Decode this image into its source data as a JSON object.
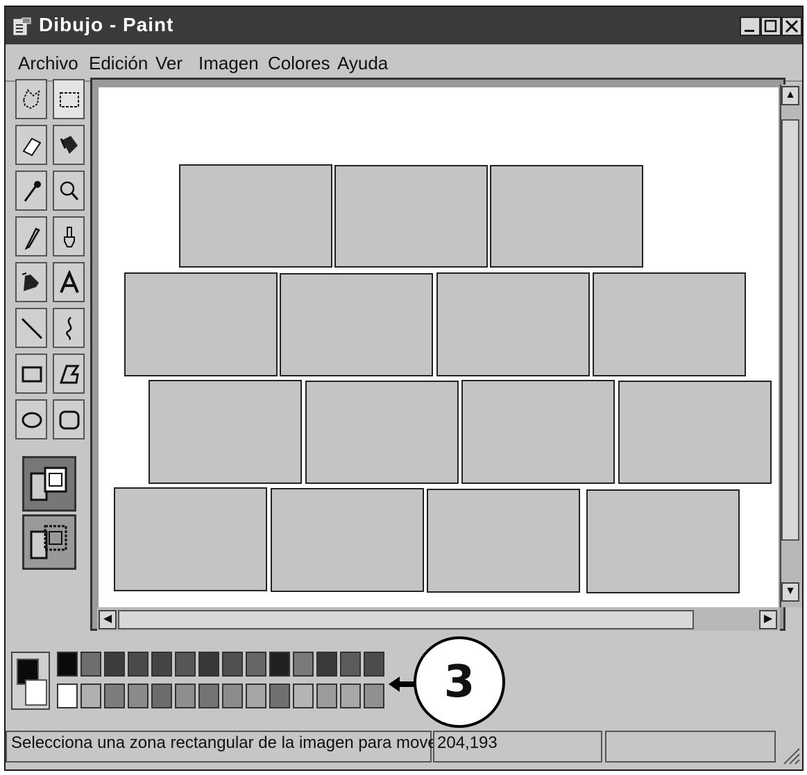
{
  "window": {
    "title": "Dibujo - Paint",
    "controls": [
      "minimize",
      "maximize",
      "close"
    ]
  },
  "menu": {
    "items": [
      "Archivo",
      "Edición",
      "Ver",
      "Imagen",
      "Colores",
      "Ayuda"
    ]
  },
  "toolbox": {
    "tools": [
      "free-select-icon",
      "rect-select-icon",
      "eraser-icon",
      "fill-bucket-icon",
      "color-picker-icon",
      "magnifier-icon",
      "pencil-icon",
      "brush-icon",
      "airbrush-icon",
      "text-icon",
      "line-icon",
      "curve-icon",
      "rectangle-icon",
      "polygon-icon",
      "ellipse-icon",
      "rounded-rect-icon"
    ],
    "options": [
      "opaque-background-icon",
      "transparent-background-icon"
    ]
  },
  "canvas": {
    "content": "brick-wall-drawing",
    "brick_fill": "#c4c4c4",
    "rows": [
      3,
      4,
      4,
      4
    ]
  },
  "palette": {
    "top_row": [
      "#0a0a0a",
      "#6e6e6e",
      "#3c3c3c",
      "#4a4a4a",
      "#444444",
      "#565656",
      "#383838",
      "#505050",
      "#666666",
      "#202020",
      "#7a7a7a",
      "#3a3a3a",
      "#5c5c5c",
      "#4c4c4c"
    ],
    "bottom_row": [
      "#ffffff",
      "#b0b0b0",
      "#7c7c7c",
      "#8a8a8a",
      "#6c6c6c",
      "#8e8e8e",
      "#747474",
      "#8c8c8c",
      "#a6a6a6",
      "#707070",
      "#b4b4b4",
      "#9c9c9c",
      "#a8a8a8",
      "#909090"
    ]
  },
  "callout": {
    "number": "3"
  },
  "statusbar": {
    "message": "Selecciona una zona rectangular de la imagen para moverla",
    "coords": "204,193"
  }
}
